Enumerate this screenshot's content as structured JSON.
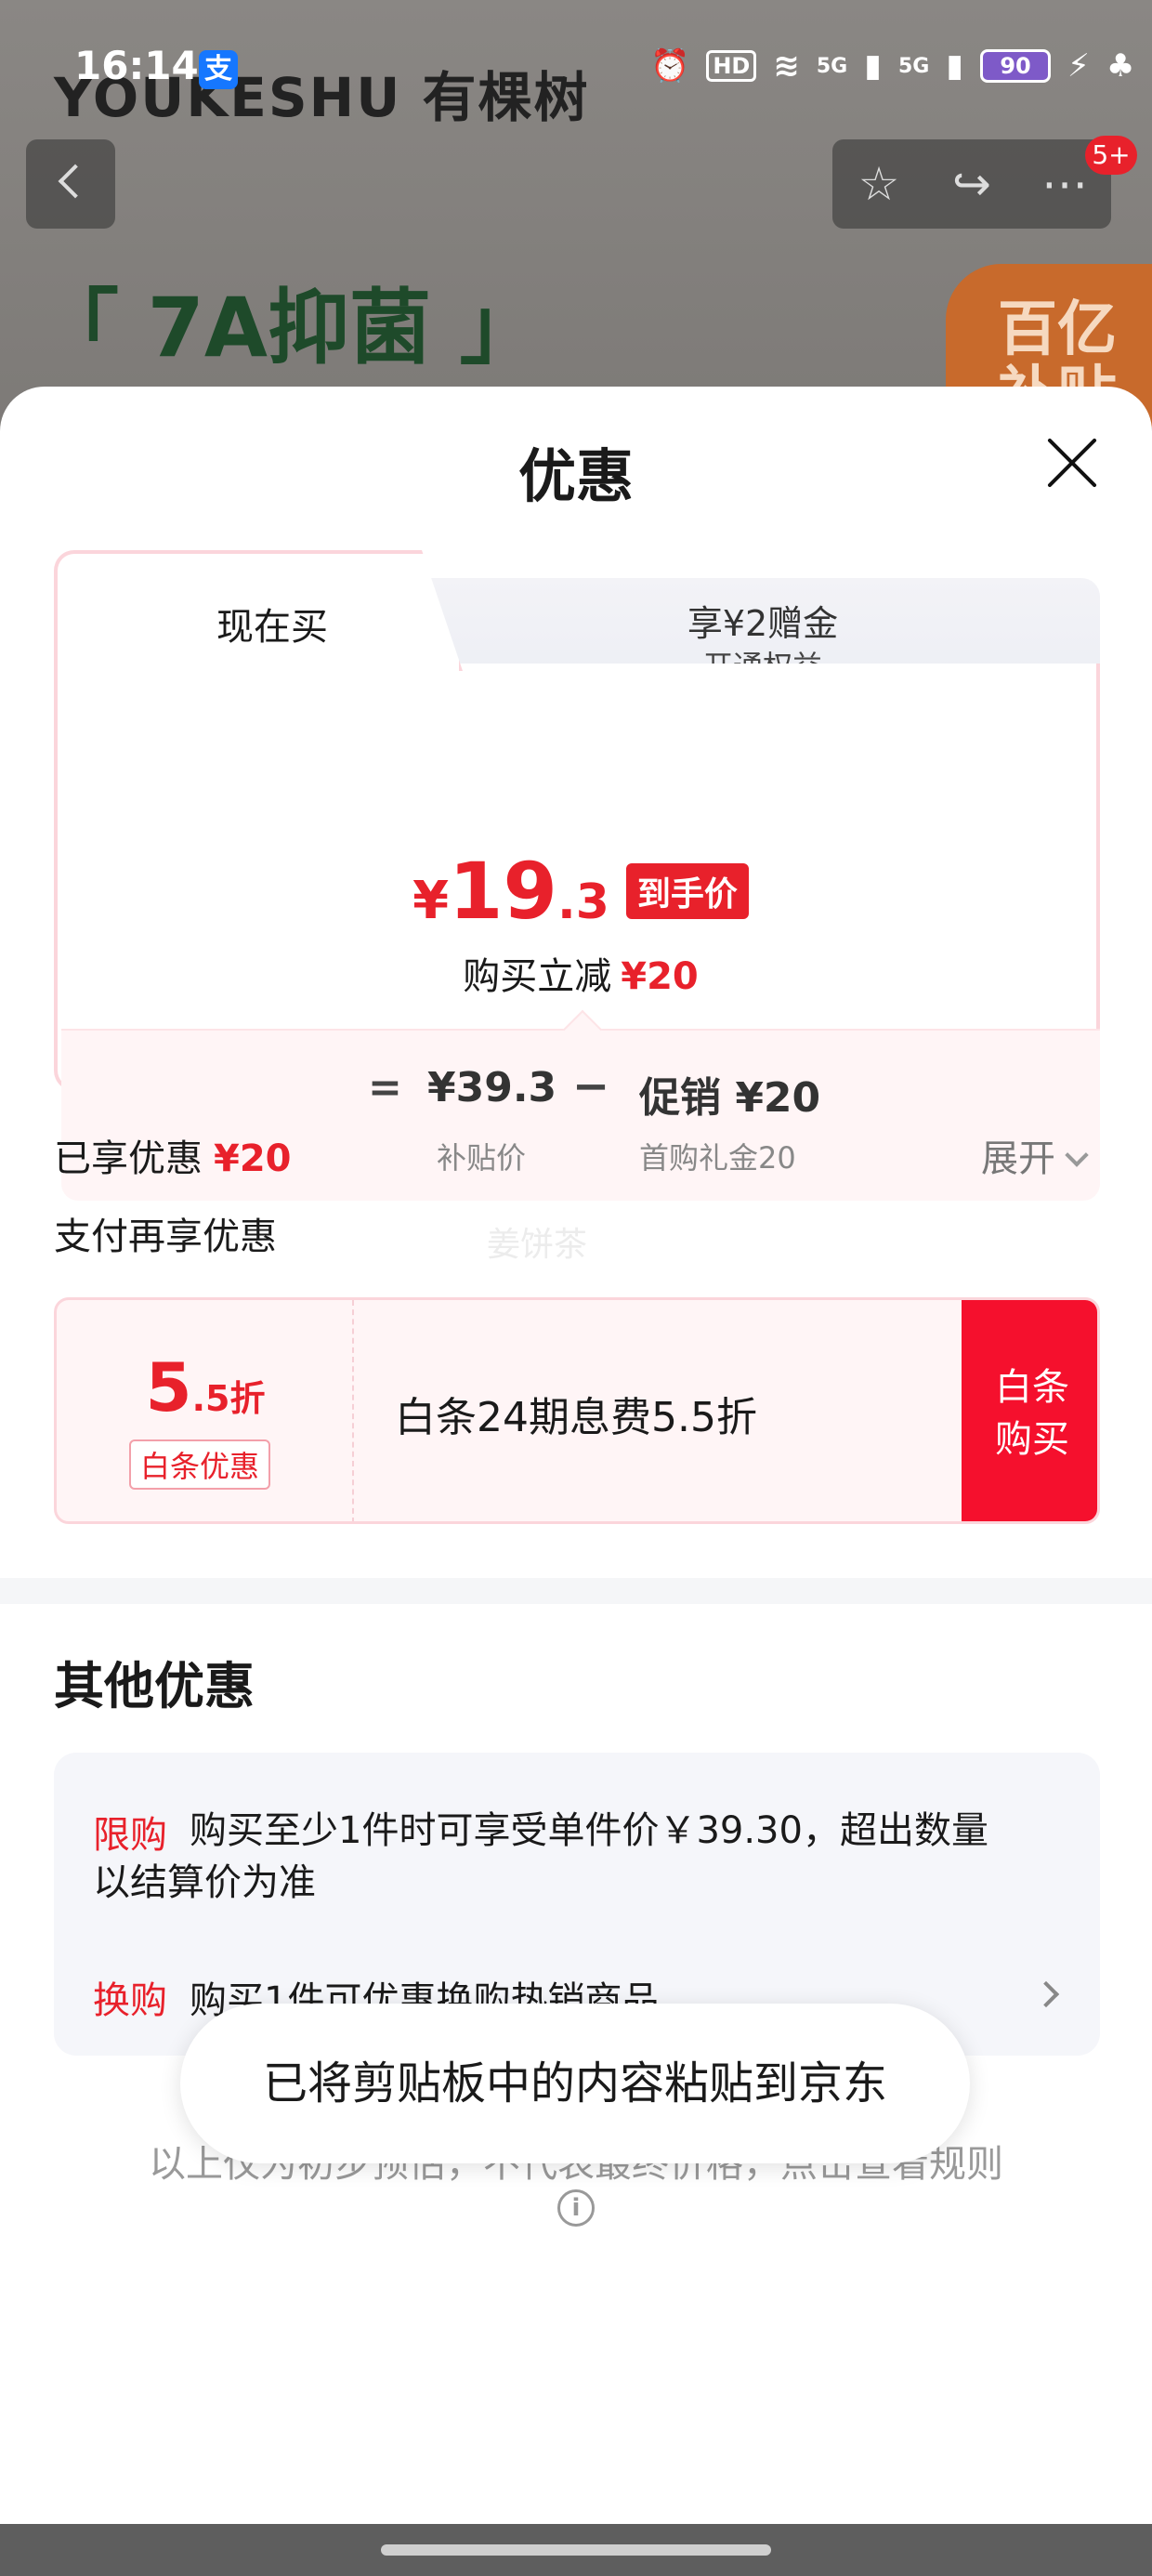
{
  "status_bar": {
    "time": "16:14",
    "alipay_label": "支",
    "hd_label": "HD",
    "signal_1": "5G",
    "signal_2": "5G",
    "battery": "90"
  },
  "background": {
    "brand_logo": "YOUKESHU 有棵树",
    "slogan": "「 7A抑菌 」",
    "badge_line1": "百亿",
    "badge_line2": "补贴",
    "notification_count": "5+"
  },
  "sheet": {
    "title": "优惠",
    "tabs": [
      {
        "label": "现在买",
        "active": true
      },
      {
        "label": "享¥2赠金",
        "sub": "开通权益",
        "active": false
      }
    ],
    "price": {
      "currency": "¥",
      "integer": "19",
      "decimal": ".3",
      "tag": "到手价",
      "reduce_label": "购买立减",
      "reduce_amount": "¥20"
    },
    "calc": {
      "eq": "=",
      "value1": "¥39.3",
      "minus": "−",
      "value2": "促销 ¥20",
      "label1": "补贴价",
      "label2": "首购礼金20"
    },
    "enjoyed_label": "已享优惠",
    "enjoyed_amount": "¥20",
    "expand_label": "展开",
    "pay_more_label": "支付再享优惠",
    "watermark": "姜饼茶",
    "baitiao": {
      "rate_num": "5",
      "rate_unit": ".5折",
      "tag": "白条优惠",
      "text": "白条24期息费5.5折",
      "buy_line1": "白条",
      "buy_line2": "购买"
    },
    "other": {
      "title": "其他优惠",
      "limit_tag": "限购",
      "limit_text": "购买至少1件时可享受单件价￥39.30，超出数量以结算价为准",
      "swap_tag": "换购",
      "swap_text": "购买1件可优惠换购热销商品"
    },
    "disclaimer": "以上仅为初步预估，不代表最终价格，点击查看规则",
    "info_icon": "i"
  },
  "toast": "已将剪贴板中的内容粘贴到京东",
  "colors": {
    "accent_red": "#e8212b",
    "buy_red": "#f5102d",
    "pink_border": "#fbd5db"
  }
}
